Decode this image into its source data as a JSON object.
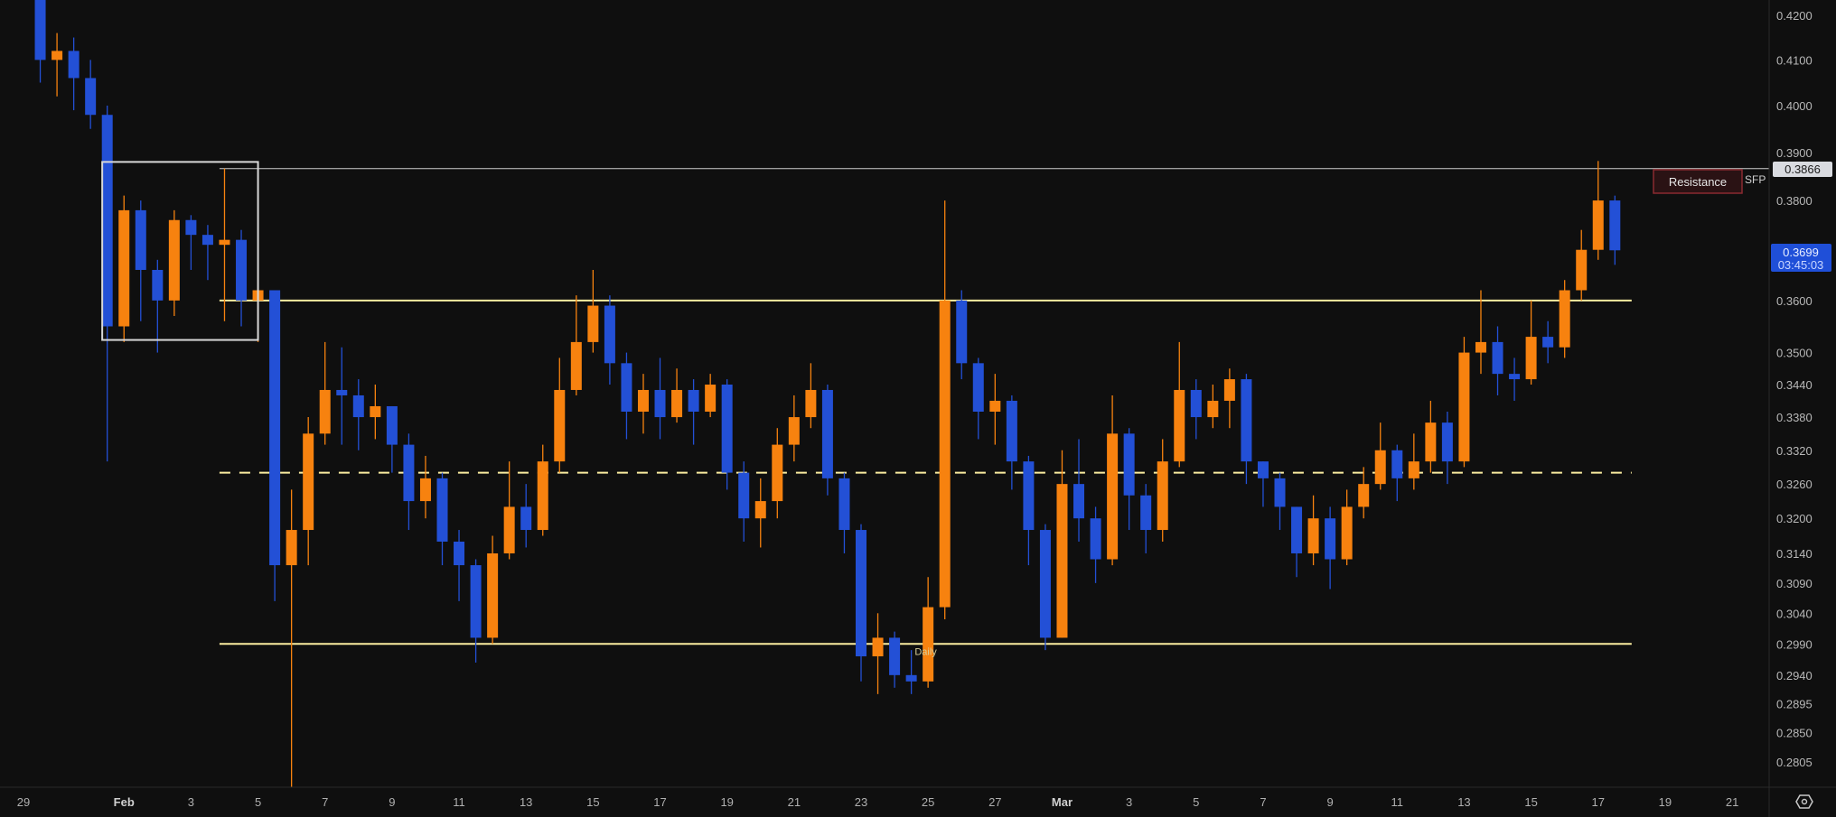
{
  "chart_data": {
    "type": "candlestick",
    "title": "",
    "scale": "log",
    "ylim": [
      0.2805,
      0.42
    ],
    "xlim_days": [
      0,
      52
    ],
    "colors": {
      "up": "#f7820f",
      "down": "#2350d6",
      "level": "#fbeda0",
      "box": "#d8d8d8",
      "background": "#0f0f0f"
    },
    "y_ticks": [
      "0.4200",
      "0.4100",
      "0.4000",
      "0.3900",
      "0.3800",
      "0.3600",
      "0.3500",
      "0.3440",
      "0.3380",
      "0.3320",
      "0.3260",
      "0.3200",
      "0.3140",
      "0.3090",
      "0.3040",
      "0.2990",
      "0.2940",
      "0.2895",
      "0.2850",
      "0.2805"
    ],
    "x_ticks": [
      {
        "d": 0,
        "label": "29"
      },
      {
        "d": 3,
        "label": "Feb",
        "month": true
      },
      {
        "d": 5,
        "label": "3"
      },
      {
        "d": 7,
        "label": "5"
      },
      {
        "d": 9,
        "label": "7"
      },
      {
        "d": 11,
        "label": "9"
      },
      {
        "d": 13,
        "label": "11"
      },
      {
        "d": 15,
        "label": "13"
      },
      {
        "d": 17,
        "label": "15"
      },
      {
        "d": 19,
        "label": "17"
      },
      {
        "d": 21,
        "label": "19"
      },
      {
        "d": 23,
        "label": "21"
      },
      {
        "d": 25,
        "label": "23"
      },
      {
        "d": 27,
        "label": "25"
      },
      {
        "d": 29,
        "label": "27"
      },
      {
        "d": 31,
        "label": "Mar",
        "month": true
      },
      {
        "d": 33,
        "label": "3"
      },
      {
        "d": 35,
        "label": "5"
      },
      {
        "d": 37,
        "label": "7"
      },
      {
        "d": 39,
        "label": "9"
      },
      {
        "d": 41,
        "label": "11"
      },
      {
        "d": 43,
        "label": "13"
      },
      {
        "d": 45,
        "label": "15"
      },
      {
        "d": 47,
        "label": "17"
      },
      {
        "d": 49,
        "label": "19"
      },
      {
        "d": 51,
        "label": "21"
      }
    ],
    "candles_fields": [
      "day",
      "open",
      "high",
      "low",
      "close"
    ],
    "candles": [
      [
        0.5,
        0.425,
        0.43,
        0.405,
        0.41
      ],
      [
        1,
        0.41,
        0.416,
        0.402,
        0.412
      ],
      [
        1.5,
        0.412,
        0.415,
        0.399,
        0.406
      ],
      [
        2,
        0.406,
        0.41,
        0.395,
        0.398
      ],
      [
        2.5,
        0.398,
        0.4,
        0.33,
        0.355
      ],
      [
        3,
        0.355,
        0.381,
        0.352,
        0.378
      ],
      [
        3.5,
        0.378,
        0.38,
        0.356,
        0.366
      ],
      [
        4,
        0.366,
        0.368,
        0.35,
        0.36
      ],
      [
        4.5,
        0.36,
        0.378,
        0.357,
        0.376
      ],
      [
        5,
        0.376,
        0.377,
        0.366,
        0.373
      ],
      [
        5.5,
        0.373,
        0.375,
        0.364,
        0.371
      ],
      [
        6,
        0.371,
        0.3866,
        0.356,
        0.372
      ],
      [
        6.5,
        0.372,
        0.374,
        0.355,
        0.36
      ],
      [
        7,
        0.36,
        0.366,
        0.352,
        0.362
      ],
      [
        7.5,
        0.362,
        0.362,
        0.306,
        0.312
      ],
      [
        8,
        0.312,
        0.325,
        0.272,
        0.318
      ],
      [
        8.5,
        0.318,
        0.338,
        0.312,
        0.335
      ],
      [
        9,
        0.335,
        0.352,
        0.333,
        0.343
      ],
      [
        9.5,
        0.343,
        0.351,
        0.333,
        0.342
      ],
      [
        10,
        0.342,
        0.345,
        0.332,
        0.338
      ],
      [
        10.5,
        0.338,
        0.344,
        0.334,
        0.34
      ],
      [
        11,
        0.34,
        0.34,
        0.328,
        0.333
      ],
      [
        11.5,
        0.333,
        0.335,
        0.318,
        0.323
      ],
      [
        12,
        0.323,
        0.331,
        0.32,
        0.327
      ],
      [
        12.5,
        0.327,
        0.328,
        0.312,
        0.316
      ],
      [
        13,
        0.316,
        0.318,
        0.306,
        0.312
      ],
      [
        13.5,
        0.312,
        0.313,
        0.296,
        0.3
      ],
      [
        14,
        0.3,
        0.317,
        0.299,
        0.314
      ],
      [
        14.5,
        0.314,
        0.33,
        0.313,
        0.322
      ],
      [
        15,
        0.322,
        0.326,
        0.315,
        0.318
      ],
      [
        15.5,
        0.318,
        0.333,
        0.317,
        0.33
      ],
      [
        16,
        0.33,
        0.349,
        0.328,
        0.343
      ],
      [
        16.5,
        0.343,
        0.361,
        0.342,
        0.352
      ],
      [
        17,
        0.352,
        0.366,
        0.35,
        0.359
      ],
      [
        17.5,
        0.359,
        0.361,
        0.344,
        0.348
      ],
      [
        18,
        0.348,
        0.35,
        0.334,
        0.339
      ],
      [
        18.5,
        0.339,
        0.346,
        0.335,
        0.343
      ],
      [
        19,
        0.343,
        0.349,
        0.334,
        0.338
      ],
      [
        19.5,
        0.338,
        0.347,
        0.337,
        0.343
      ],
      [
        20,
        0.343,
        0.345,
        0.333,
        0.339
      ],
      [
        20.5,
        0.339,
        0.346,
        0.338,
        0.344
      ],
      [
        21,
        0.344,
        0.345,
        0.325,
        0.328
      ],
      [
        21.5,
        0.328,
        0.33,
        0.316,
        0.32
      ],
      [
        22,
        0.32,
        0.327,
        0.315,
        0.323
      ],
      [
        22.5,
        0.323,
        0.336,
        0.32,
        0.333
      ],
      [
        23,
        0.333,
        0.342,
        0.33,
        0.338
      ],
      [
        23.5,
        0.338,
        0.348,
        0.336,
        0.343
      ],
      [
        24,
        0.343,
        0.344,
        0.324,
        0.327
      ],
      [
        24.5,
        0.327,
        0.328,
        0.314,
        0.318
      ],
      [
        25,
        0.318,
        0.319,
        0.293,
        0.297
      ],
      [
        25.5,
        0.297,
        0.304,
        0.291,
        0.3
      ],
      [
        26,
        0.3,
        0.301,
        0.292,
        0.294
      ],
      [
        26.5,
        0.294,
        0.298,
        0.291,
        0.293
      ],
      [
        27,
        0.293,
        0.31,
        0.292,
        0.305
      ],
      [
        27.5,
        0.305,
        0.38,
        0.303,
        0.36
      ],
      [
        28,
        0.36,
        0.362,
        0.345,
        0.348
      ],
      [
        28.5,
        0.348,
        0.349,
        0.334,
        0.339
      ],
      [
        29,
        0.339,
        0.346,
        0.333,
        0.341
      ],
      [
        29.5,
        0.341,
        0.342,
        0.325,
        0.33
      ],
      [
        30,
        0.33,
        0.331,
        0.312,
        0.318
      ],
      [
        30.5,
        0.318,
        0.319,
        0.298,
        0.3
      ],
      [
        31,
        0.3,
        0.332,
        0.3,
        0.326
      ],
      [
        31.5,
        0.326,
        0.334,
        0.316,
        0.32
      ],
      [
        32,
        0.32,
        0.322,
        0.309,
        0.313
      ],
      [
        32.5,
        0.313,
        0.342,
        0.312,
        0.335
      ],
      [
        33,
        0.335,
        0.336,
        0.318,
        0.324
      ],
      [
        33.5,
        0.324,
        0.326,
        0.314,
        0.318
      ],
      [
        34,
        0.318,
        0.334,
        0.316,
        0.33
      ],
      [
        34.5,
        0.33,
        0.352,
        0.329,
        0.343
      ],
      [
        35,
        0.343,
        0.345,
        0.334,
        0.338
      ],
      [
        35.5,
        0.338,
        0.344,
        0.336,
        0.341
      ],
      [
        36,
        0.341,
        0.347,
        0.336,
        0.345
      ],
      [
        36.5,
        0.345,
        0.346,
        0.326,
        0.33
      ],
      [
        37,
        0.33,
        0.33,
        0.322,
        0.327
      ],
      [
        37.5,
        0.327,
        0.328,
        0.318,
        0.322
      ],
      [
        38,
        0.322,
        0.322,
        0.31,
        0.314
      ],
      [
        38.5,
        0.314,
        0.324,
        0.312,
        0.32
      ],
      [
        39,
        0.32,
        0.322,
        0.308,
        0.313
      ],
      [
        39.5,
        0.313,
        0.325,
        0.312,
        0.322
      ],
      [
        40,
        0.322,
        0.329,
        0.32,
        0.326
      ],
      [
        40.5,
        0.326,
        0.337,
        0.325,
        0.332
      ],
      [
        41,
        0.332,
        0.333,
        0.323,
        0.327
      ],
      [
        41.5,
        0.327,
        0.335,
        0.325,
        0.33
      ],
      [
        42,
        0.33,
        0.341,
        0.328,
        0.337
      ],
      [
        42.5,
        0.337,
        0.339,
        0.326,
        0.33
      ],
      [
        43,
        0.33,
        0.353,
        0.329,
        0.35
      ],
      [
        43.5,
        0.35,
        0.362,
        0.346,
        0.352
      ],
      [
        44,
        0.352,
        0.355,
        0.342,
        0.346
      ],
      [
        44.5,
        0.346,
        0.349,
        0.341,
        0.345
      ],
      [
        45,
        0.345,
        0.36,
        0.344,
        0.353
      ],
      [
        45.5,
        0.353,
        0.356,
        0.348,
        0.351
      ],
      [
        46,
        0.351,
        0.364,
        0.349,
        0.362
      ],
      [
        46.5,
        0.362,
        0.374,
        0.36,
        0.37
      ],
      [
        47,
        0.37,
        0.3882,
        0.368,
        0.38
      ],
      [
        47.5,
        0.38,
        0.381,
        0.367,
        0.3699
      ]
    ],
    "annotations": {
      "range_box": {
        "d_start": 2.35,
        "d_end": 7.0,
        "price_top": 0.388,
        "price_bottom": 0.3524
      },
      "sfp_line": {
        "price": 0.3866,
        "d_start": 5.85,
        "label": "SFP"
      },
      "resistance_level": {
        "price": 0.36,
        "d_start": 5.85,
        "d_end": 48.0
      },
      "mid_level": {
        "price": 0.328,
        "d_start": 5.85,
        "d_end": 48.0,
        "style": "dashed"
      },
      "support_level": {
        "price": 0.299,
        "d_start": 5.85,
        "d_end": 48.0,
        "label": "Daily",
        "label_d": 26.6
      },
      "resistance_label": "Resistance"
    }
  },
  "price_scale": {
    "marker_price": "0.3866",
    "current_price": "0.3699",
    "countdown": "03:45:03"
  },
  "icons": {
    "settings": "settings-hexagon-icon"
  }
}
